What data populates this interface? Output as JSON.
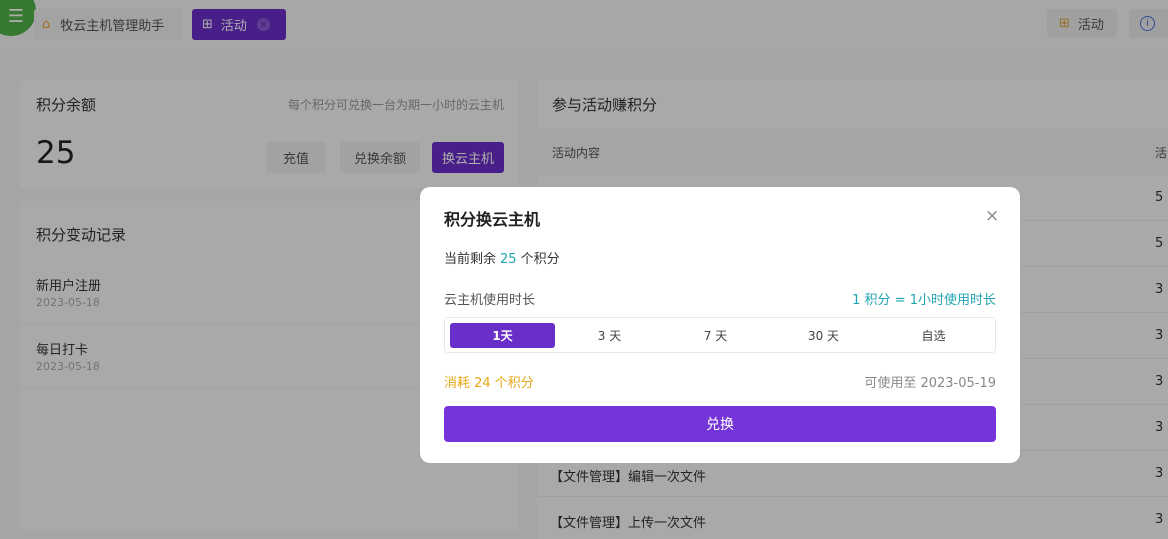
{
  "logo": {
    "glyph": "☰"
  },
  "tabs": [
    {
      "label": "牧云主机管理助手",
      "icon": "home-icon"
    },
    {
      "label": "活动",
      "icon": "gift-icon",
      "active": true
    }
  ],
  "top_right": {
    "activity_label": "活动"
  },
  "balance": {
    "title": "积分余额",
    "hint": "每个积分可兑换一台为期一小时的云主机",
    "value": "25",
    "buttons": {
      "recharge": "充值",
      "exchange_balance": "兑换余额",
      "exchange_host": "换云主机"
    }
  },
  "records": {
    "title": "积分变动记录",
    "items": [
      {
        "name": "新用户注册",
        "date": "2023-05-18"
      },
      {
        "name": "每日打卡",
        "date": "2023-05-18"
      }
    ]
  },
  "earn": {
    "title": "参与活动赚积分",
    "columns": [
      "活动内容",
      "活"
    ],
    "rows": [
      {
        "content": "",
        "value": "5"
      },
      {
        "content": "",
        "value": "5"
      },
      {
        "content": "",
        "value": "3"
      },
      {
        "content": "",
        "value": "3"
      },
      {
        "content": "",
        "value": "3"
      },
      {
        "content": "",
        "value": "3"
      },
      {
        "content": "【文件管理】编辑一次文件",
        "value": "3"
      },
      {
        "content": "【文件管理】上传一次文件",
        "value": "3"
      }
    ]
  },
  "modal": {
    "title": "积分换云主机",
    "close_glyph": "×",
    "remain_prefix": "当前剩余",
    "remain_value": "25",
    "remain_suffix": "个积分",
    "duration_label": "云主机使用时长",
    "rate": "1 积分 = 1小时使用时长",
    "options": [
      "1天",
      "3 天",
      "7 天",
      "30 天",
      "自选"
    ],
    "selected_option": "1天",
    "cost": "消耗 24 个积分",
    "valid_until": "可使用至 2023-05-19",
    "submit": "兑换"
  },
  "colors": {
    "accent": "#6a2fc9",
    "teal": "#20a4b0",
    "amber": "#e7a817",
    "logo": "#53b34a"
  }
}
